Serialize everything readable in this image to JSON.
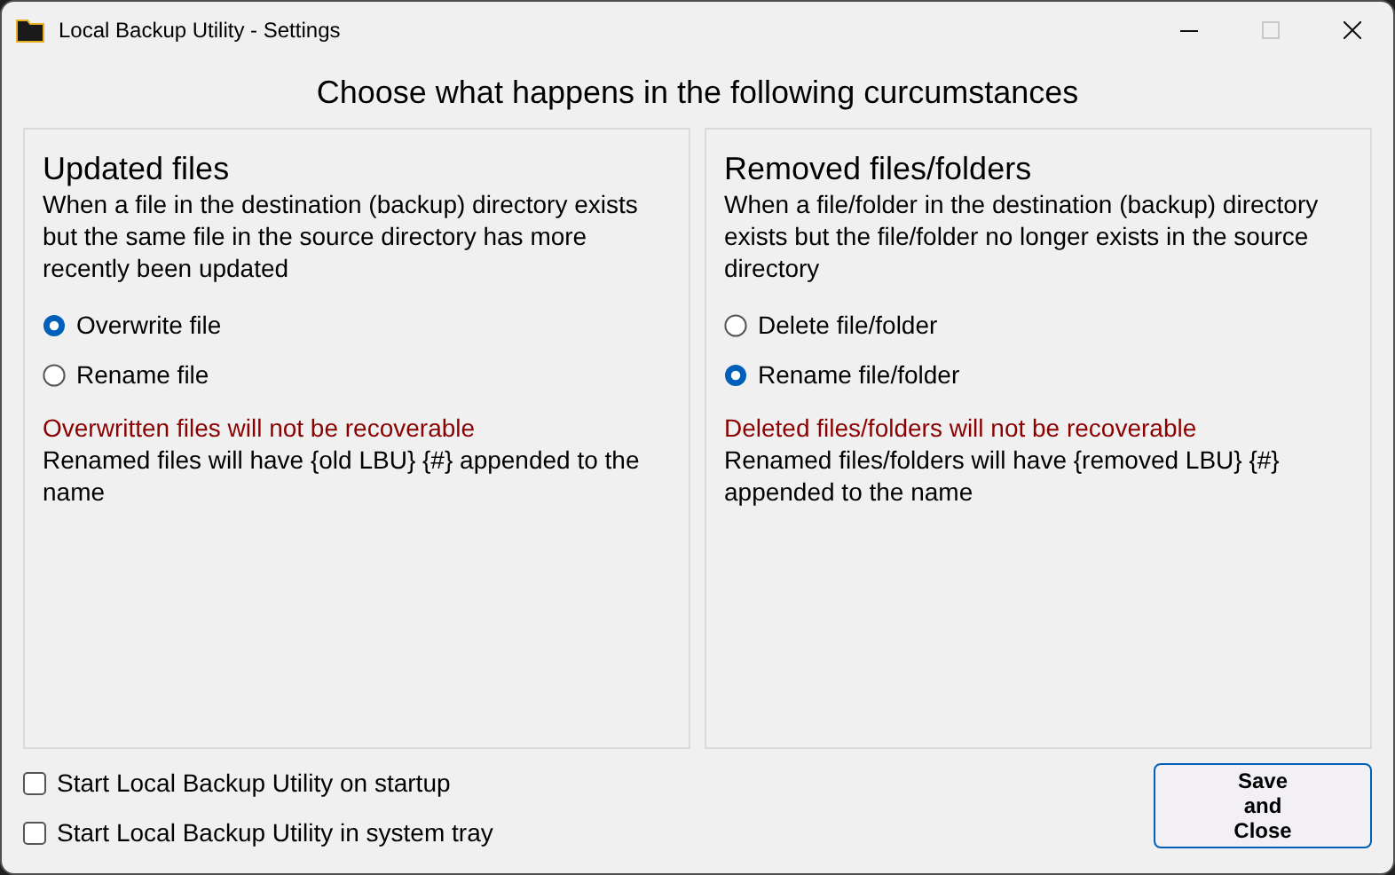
{
  "window": {
    "title": "Local Backup Utility - Settings",
    "controls": [
      {
        "kind": "minimize",
        "disabled": false
      },
      {
        "kind": "maximize",
        "disabled": true
      },
      {
        "kind": "close",
        "disabled": false
      }
    ]
  },
  "heading": "Choose what happens in the following curcumstances",
  "panels": [
    {
      "title": "Updated files",
      "description": "When a file in the destination (backup) directory exists but the same file in the source directory has more recently been updated",
      "options": [
        {
          "label": "Overwrite file",
          "selected": true
        },
        {
          "label": "Rename file",
          "selected": false
        }
      ],
      "warning": "Overwritten files will not be recoverable",
      "note": "Renamed files will have {old LBU} {#} appended to the name"
    },
    {
      "title": "Removed files/folders",
      "description": "When a file/folder in the destination (backup) directory exists but the file/folder no longer exists in the source directory",
      "options": [
        {
          "label": "Delete file/folder",
          "selected": false
        },
        {
          "label": "Rename file/folder",
          "selected": true
        }
      ],
      "warning": "Deleted files/folders will not be recoverable",
      "note": "Renamed files/folders will have {removed LBU} {#} appended to the name"
    }
  ],
  "checkboxes": [
    {
      "label": "Start Local Backup Utility on startup",
      "checked": false
    },
    {
      "label": "Start Local Backup Utility in system tray",
      "checked": false
    }
  ],
  "save_button": "Save and Close"
}
